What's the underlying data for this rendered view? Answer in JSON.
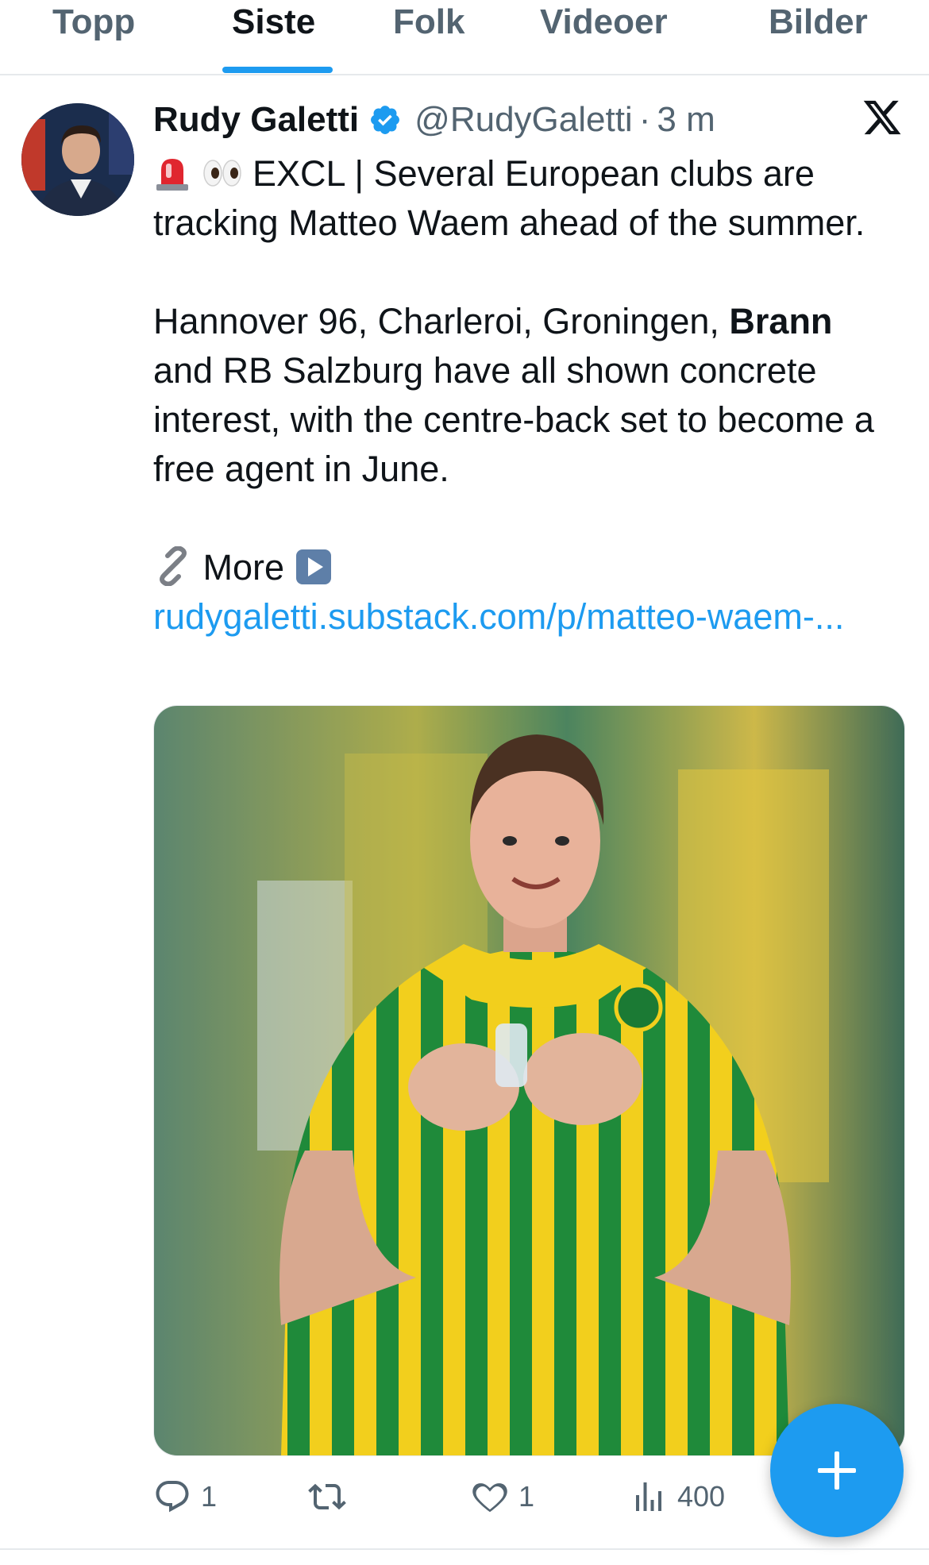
{
  "tabs": [
    {
      "label": "Topp",
      "active": false
    },
    {
      "label": "Siste",
      "active": true
    },
    {
      "label": "Folk",
      "active": false
    },
    {
      "label": "Videoer",
      "active": false
    },
    {
      "label": "Bilder",
      "active": false
    }
  ],
  "tweet": {
    "author_name": "Rudy Galetti",
    "handle": "@RudyGaletti",
    "separator": "·",
    "time": "3 m",
    "lines": {
      "line1": "EXCL | Several European clubs are tracking Matteo Waem ahead of the summer.",
      "line2_pre": "Hannover 96, Charleroi, Groningen, ",
      "line2_bold": "Brann",
      "line2_post": " and RB Salzburg have all shown concrete interest, with the centre-back set to become a free agent in June.",
      "more_label": "More",
      "link_text": "rudygaletti.substack.com/p/matteo-waem-..."
    },
    "emojis": [
      "rotating-light",
      "eyes",
      "link",
      "play-button"
    ]
  },
  "actions": {
    "replies": "1",
    "reposts": "",
    "likes": "1",
    "views": "400"
  },
  "colors": {
    "accent": "#1d9bf0",
    "text": "#0f1419",
    "secondary": "#536471",
    "verified": "#1d9bf0"
  }
}
